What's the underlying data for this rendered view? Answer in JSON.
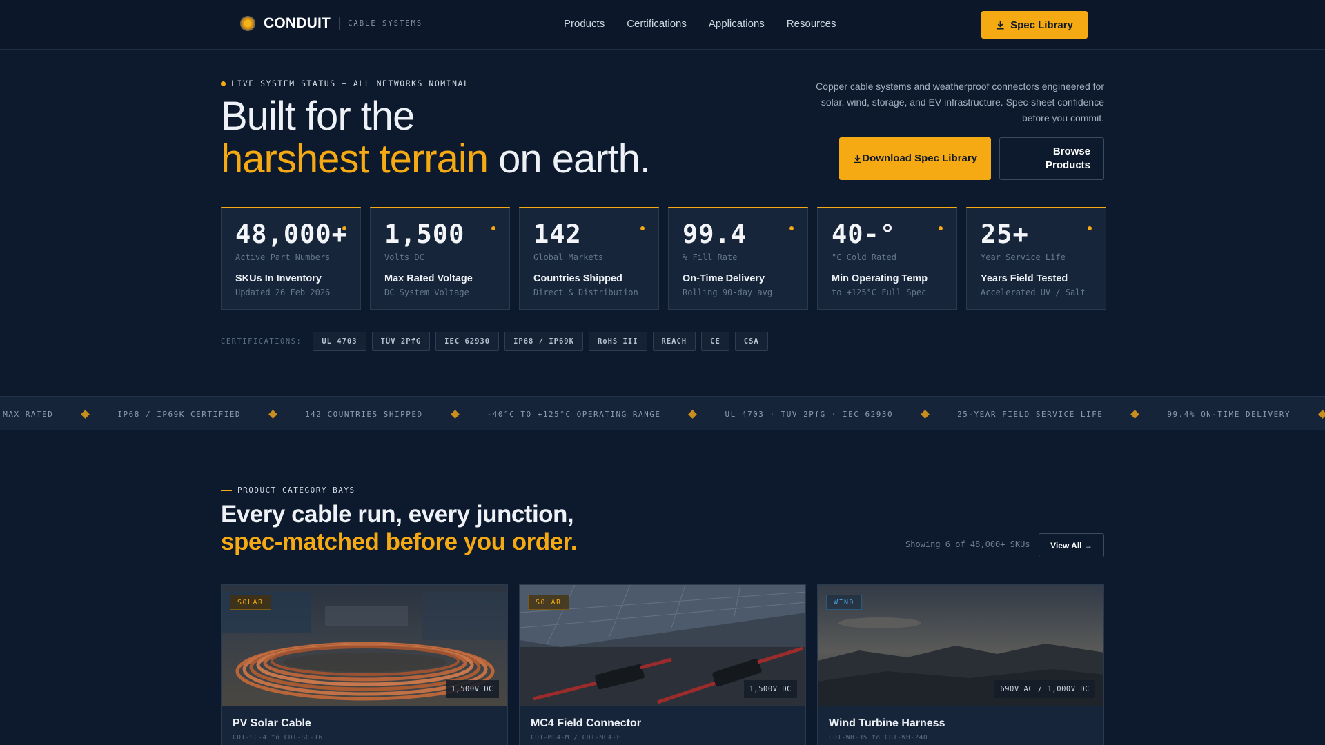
{
  "nav": {
    "brand": "CONDUIT",
    "brand_sub": "CABLE SYSTEMS",
    "links": [
      "Products",
      "Certifications",
      "Applications",
      "Resources"
    ],
    "cta": "Spec Library"
  },
  "hero": {
    "status": "LIVE SYSTEM STATUS — ALL NETWORKS NOMINAL",
    "title_line1": "Built for the",
    "title_accent": "harshest terrain",
    "title_rest": " on earth.",
    "description": "Copper cable systems and weatherproof connectors engineered for solar, wind, storage, and EV infrastructure. Spec-sheet confidence before you commit.",
    "btn_primary": "Download Spec Library",
    "btn_secondary": "Browse Products"
  },
  "stats": [
    {
      "value": "48,000+",
      "unit": "Active Part Numbers",
      "label": "SKUs In Inventory",
      "sub": "Updated 26 Feb 2026"
    },
    {
      "value": "1,500",
      "unit": "Volts DC",
      "label": "Max Rated Voltage",
      "sub": "DC System Voltage"
    },
    {
      "value": "142",
      "unit": "Global Markets",
      "label": "Countries Shipped",
      "sub": "Direct & Distribution"
    },
    {
      "value": "99.4",
      "unit": "% Fill Rate",
      "label": "On-Time Delivery",
      "sub": "Rolling 90-day avg"
    },
    {
      "value": "40-°",
      "unit": "°C Cold Rated",
      "label": "Min Operating Temp",
      "sub": "to +125°C Full Spec"
    },
    {
      "value": "25+",
      "unit": "Year Service Life",
      "label": "Years Field Tested",
      "sub": "Accelerated UV / Salt"
    }
  ],
  "certifications": {
    "label": "CERTIFICATIONS:",
    "items": [
      "UL 4703",
      "TÜV 2PfG",
      "IEC 62930",
      "IP68 / IP69K",
      "RoHS III",
      "REACH",
      "CE",
      "CSA"
    ]
  },
  "ticker": [
    "C MAX RATED",
    "IP68 / IP69K CERTIFIED",
    "142 COUNTRIES SHIPPED",
    "-40°C TO +125°C OPERATING RANGE",
    "UL 4703 · TÜV 2PfG · IEC 62930",
    "25-YEAR FIELD SERVICE LIFE",
    "99.4% ON-TIME DELIVERY"
  ],
  "products_section": {
    "label": "PRODUCT CATEGORY BAYS",
    "title_line1": "Every cable run, every junction,",
    "title_accent": "spec-matched before you order.",
    "showing": "Showing 6 of 48,000+ SKUs",
    "view_all": "View All →"
  },
  "cards": [
    {
      "tag": "SOLAR",
      "spec": "1,500V DC",
      "title": "PV Solar Cable",
      "sku": "CDT-SC-4 to CDT-SC-16"
    },
    {
      "tag": "SOLAR",
      "spec": "1,500V DC",
      "title": "MC4 Field Connector",
      "sku": "CDT-MC4-M / CDT-MC4-F"
    },
    {
      "tag": "WIND",
      "spec": "690V AC / 1,000V DC",
      "title": "Wind Turbine Harness",
      "sku": "CDT-WH-35 to CDT-WH-240"
    }
  ]
}
